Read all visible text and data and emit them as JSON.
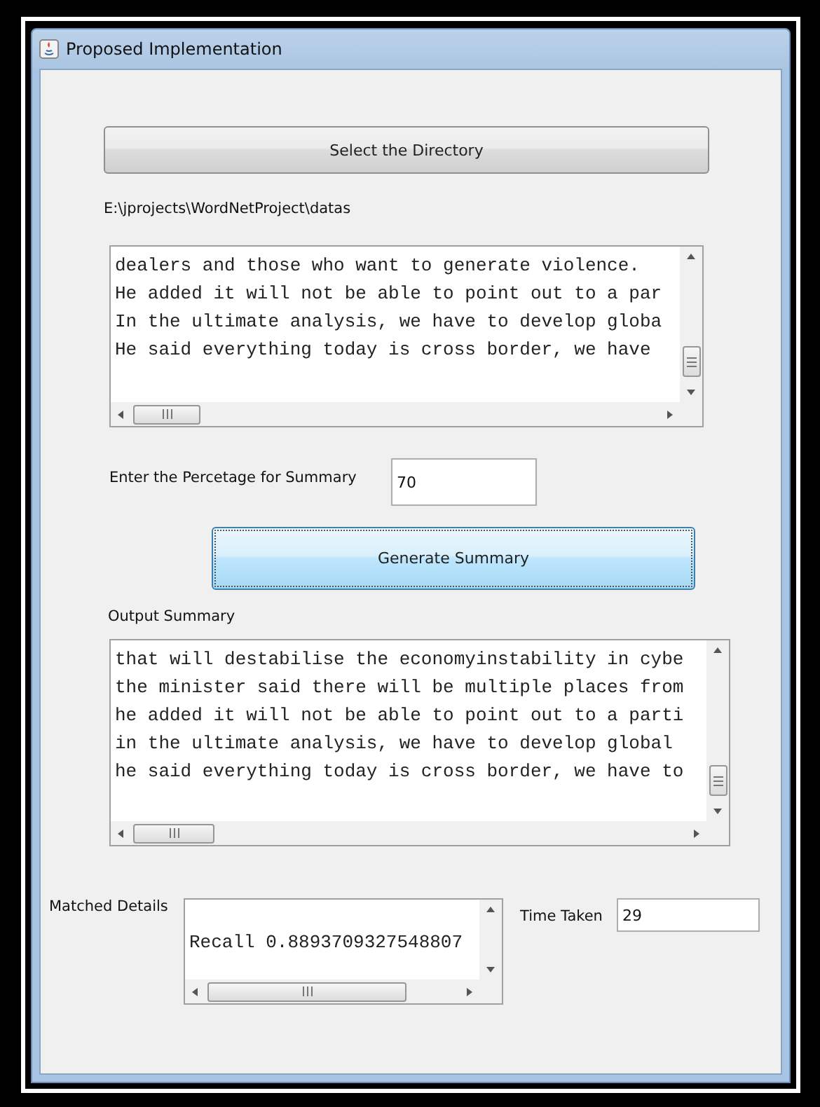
{
  "window": {
    "title": "Proposed Implementation"
  },
  "select_button": {
    "label": "Select the Directory"
  },
  "directory_path": "E:\\jprojects\\WordNetProject\\datas",
  "input_text": {
    "lines": [
      "dealers and those who want to generate violence.",
      "He added it will not be able to point out to a par",
      "In the ultimate analysis, we have to develop globa",
      "He said everything today is cross border, we have"
    ]
  },
  "percentage": {
    "label": "Enter the  Percetage for Summary",
    "value": "70"
  },
  "generate_button": {
    "label": "Generate Summary",
    "focused": true
  },
  "output": {
    "label": "Output Summary",
    "lines": [
      "that will destabilise the economyinstability in cybe",
      "the minister said there will be multiple places from",
      "he added it will not be able to point out to a parti",
      "in the ultimate analysis, we have to develop global",
      "he said everything today is cross border, we have to"
    ]
  },
  "matched": {
    "label": "Matched Details",
    "lines": [
      "Recall 0.8893709327548807"
    ]
  },
  "time_taken": {
    "label": "Time Taken",
    "value": "29"
  }
}
